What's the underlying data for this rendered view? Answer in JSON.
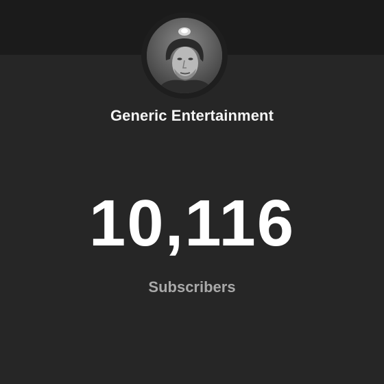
{
  "channel": {
    "name": "Generic Entertainment",
    "avatar": "channel-avatar-portrait"
  },
  "stats": {
    "subscriber_count": "10,116",
    "label": "Subscribers"
  },
  "colors": {
    "background": "#262626",
    "top_band": "#1b1b1b",
    "count_text": "#ffffff",
    "label_text": "#a9a9a9"
  }
}
